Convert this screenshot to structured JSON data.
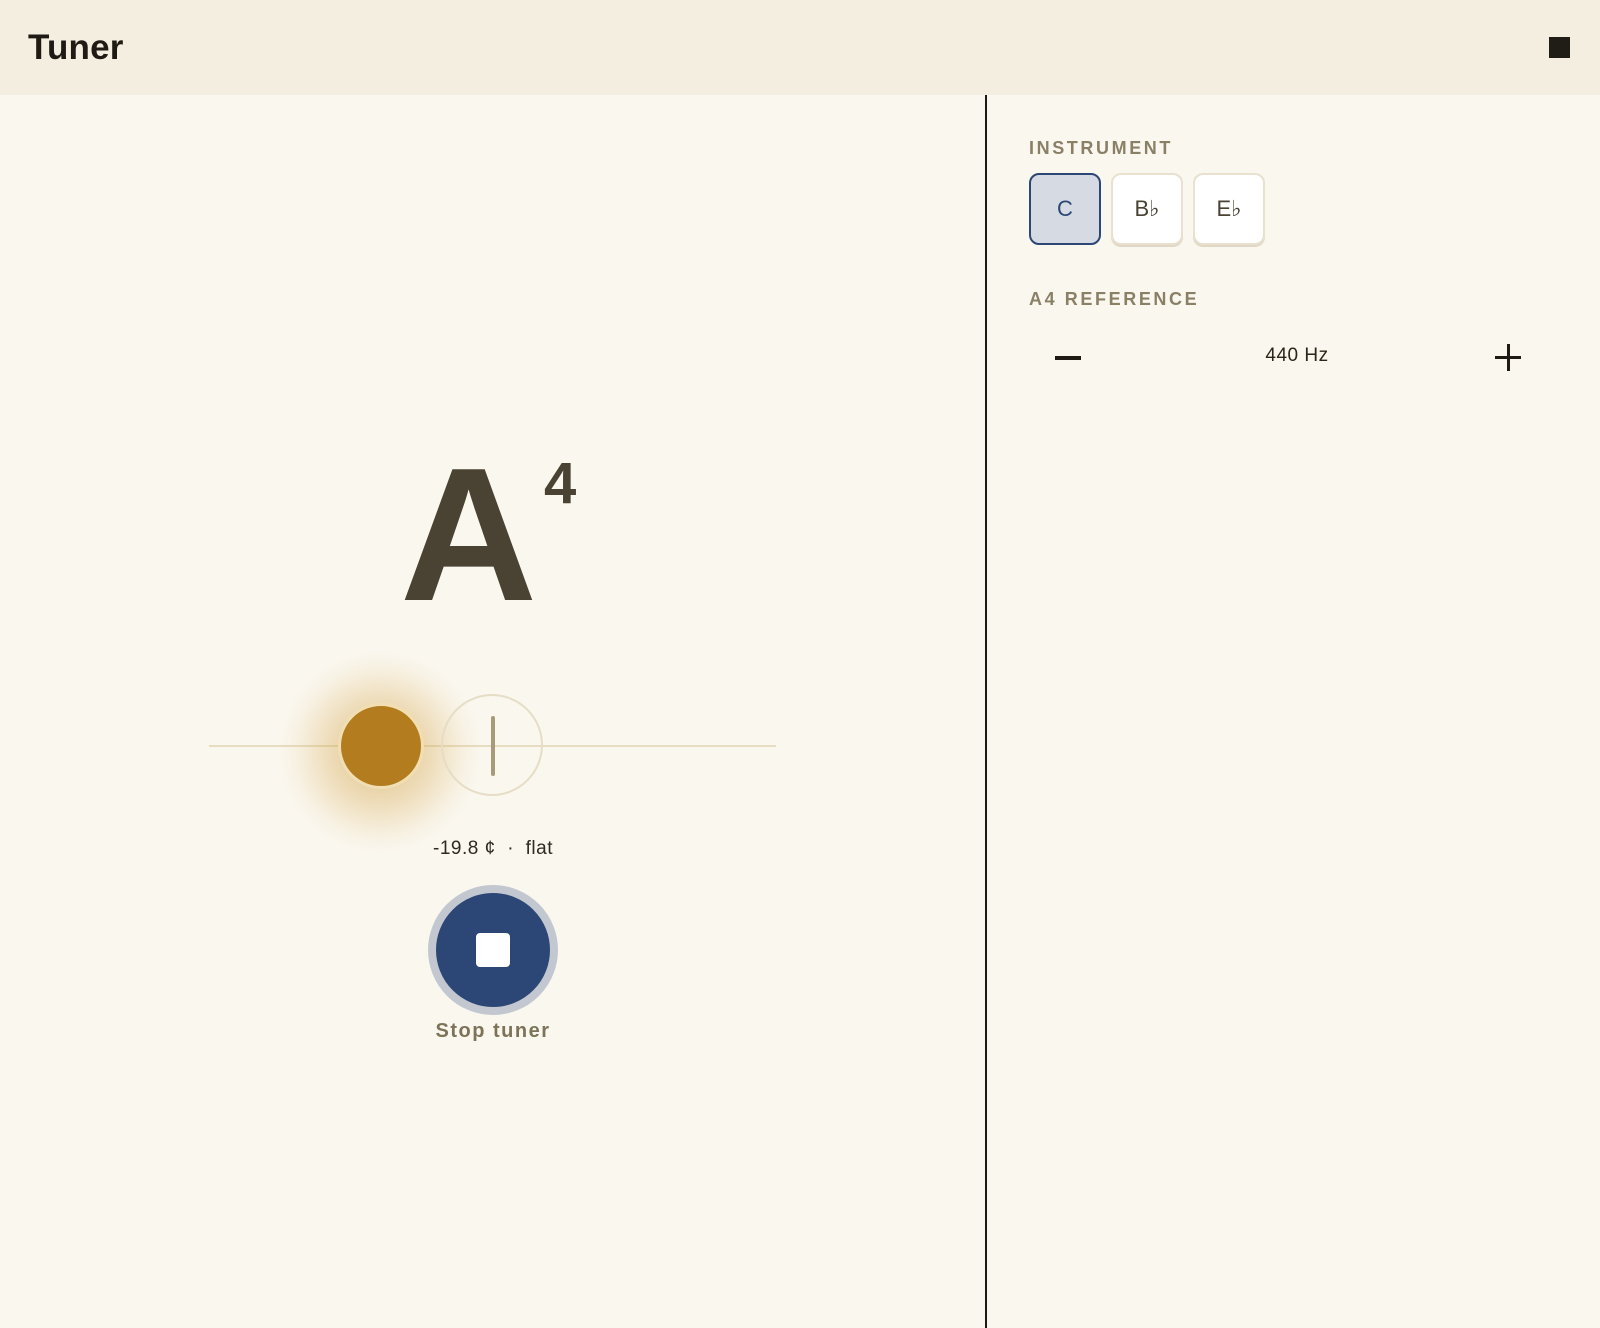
{
  "header": {
    "title": "Tuner",
    "stop_icon": "stop-square-icon"
  },
  "note": {
    "letter": "A",
    "octave": "4"
  },
  "meter": {
    "cents_value": "-19.8 ¢",
    "separator": "·",
    "status": "flat",
    "cents_offset": -19.8,
    "pitch_color": "#b37d1f"
  },
  "control": {
    "stop_label": "Stop tuner",
    "stop_icon": "stop-icon",
    "accent_color": "#2c4775"
  },
  "sidebar": {
    "instrument_label": "INSTRUMENT",
    "instruments": [
      {
        "label": "C",
        "selected": true
      },
      {
        "label": "B♭",
        "selected": false
      },
      {
        "label": "E♭",
        "selected": false
      }
    ],
    "reference_label": "A4 REFERENCE",
    "reference_value": "440",
    "reference_unit": "Hz",
    "minus_icon": "minus-icon",
    "plus_icon": "plus-icon"
  }
}
